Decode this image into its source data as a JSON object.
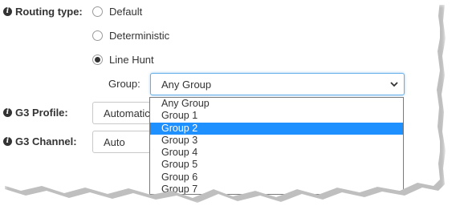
{
  "routing": {
    "label": "Routing type:",
    "options": [
      {
        "label": "Default",
        "checked": false
      },
      {
        "label": "Deterministic",
        "checked": false
      },
      {
        "label": "Line Hunt",
        "checked": true
      }
    ]
  },
  "group": {
    "label": "Group:",
    "value": "Any Group",
    "options": [
      "Any Group",
      "Group 1",
      "Group 2",
      "Group 3",
      "Group 4",
      "Group 5",
      "Group 6",
      "Group 7"
    ],
    "highlighted": "Group 2"
  },
  "g3_profile": {
    "label": "G3 Profile:",
    "value": "Automatic"
  },
  "g3_channel": {
    "label": "G3 Channel:",
    "value": "Auto"
  },
  "colors": {
    "highlight": "#1e90ff",
    "focus_border": "#66afe9"
  }
}
